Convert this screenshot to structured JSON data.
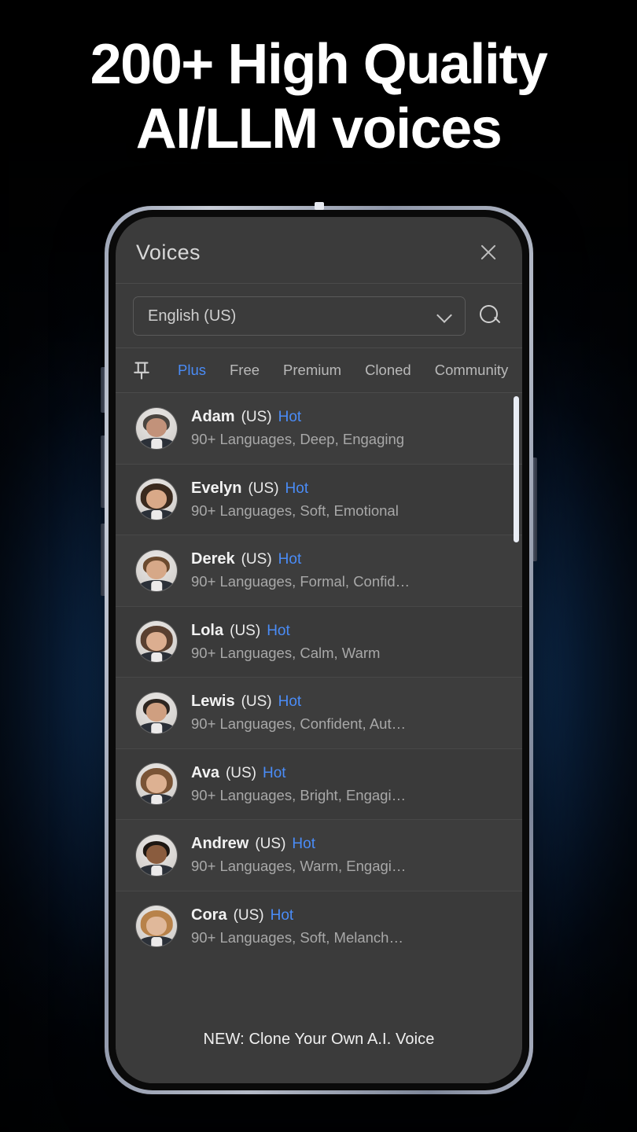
{
  "headline": {
    "line1": "200+ High Quality",
    "line2": "AI/LLM voices"
  },
  "colors": {
    "accent_blue": "#4a8cf7",
    "screen_bg": "#3b3b3b",
    "row_bg": "#3d3d3d",
    "bezel": "#b4bac7",
    "background_glow": "#1f5da3"
  },
  "sheet": {
    "title": "Voices",
    "close_icon": "close-icon"
  },
  "filter": {
    "language_value": "English (US)",
    "dropdown_icon": "chevron-down-icon",
    "search_icon": "search-icon"
  },
  "tabs": {
    "pin_icon": "pushpin-icon",
    "pin_glyph": "⁐",
    "items": [
      {
        "label": "Plus",
        "active": true
      },
      {
        "label": "Free",
        "active": false
      },
      {
        "label": "Premium",
        "active": false
      },
      {
        "label": "Cloned",
        "active": false
      },
      {
        "label": "Community",
        "active": false
      }
    ]
  },
  "voices": [
    {
      "name": "Adam",
      "locale": "(US)",
      "tag": "Hot",
      "desc": "90+ Languages, Deep, Engaging",
      "hair": "#4a4540",
      "skin": "#c2927a",
      "gender": "m"
    },
    {
      "name": "Evelyn",
      "locale": "(US)",
      "tag": "Hot",
      "desc": "90+ Languages, Soft, Emotional",
      "hair": "#3a2a1e",
      "skin": "#d9a988",
      "gender": "f"
    },
    {
      "name": "Derek",
      "locale": "(US)",
      "tag": "Hot",
      "desc": "90+ Languages, Formal, Confid…",
      "hair": "#6b4a2e",
      "skin": "#d6a888",
      "gender": "m"
    },
    {
      "name": "Lola",
      "locale": "(US)",
      "tag": "Hot",
      "desc": "90+ Languages, Calm, Warm",
      "hair": "#5a4030",
      "skin": "#dcae90",
      "gender": "f"
    },
    {
      "name": "Lewis",
      "locale": "(US)",
      "tag": "Hot",
      "desc": "90+ Languages, Confident, Aut…",
      "hair": "#2e2620",
      "skin": "#cf9f80",
      "gender": "m"
    },
    {
      "name": "Ava",
      "locale": "(US)",
      "tag": "Hot",
      "desc": "90+ Languages, Bright, Engagi…",
      "hair": "#7a5436",
      "skin": "#ddb192",
      "gender": "f"
    },
    {
      "name": "Andrew",
      "locale": "(US)",
      "tag": "Hot",
      "desc": "90+ Languages, Warm, Engagi…",
      "hair": "#1d1712",
      "skin": "#8a5c3e",
      "gender": "m"
    },
    {
      "name": "Cora",
      "locale": "(US)",
      "tag": "Hot",
      "desc": "90+ Languages, Soft, Melanch…",
      "hair": "#b8824a",
      "skin": "#e0b89a",
      "gender": "f"
    }
  ],
  "footer": {
    "text": "NEW: Clone Your Own A.I. Voice"
  }
}
